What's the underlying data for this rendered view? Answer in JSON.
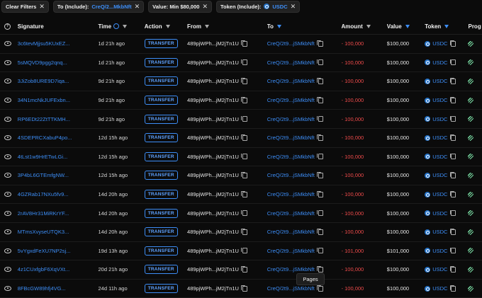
{
  "filters": {
    "clear_label": "Clear Filters",
    "to_prefix": "To (Include):",
    "to_value": "CreQ/2...MkbNft",
    "value_label": "Value: Min $80,000",
    "token_prefix": "Token (Include):",
    "token_value": "USDC"
  },
  "headers": {
    "signature": "Signature",
    "time": "Time",
    "action": "Action",
    "from": "From",
    "to": "To",
    "amount": "Amount",
    "value": "Value",
    "token": "Token",
    "program": "Prog"
  },
  "rows": [
    {
      "signature": "3c6tevMjjsu5KUxEZ...",
      "time": "1d 21h ago",
      "action": "TRANSFER",
      "from": "489pjWPh...jM2jTn1U",
      "to": "CreQ/2t9...jSMkbNft",
      "amount": "- 100,000",
      "value": "$100,000",
      "token": "USDC"
    },
    {
      "signature": "5sMQVD9pgg2qnq...",
      "time": "1d 21h ago",
      "action": "TRANSFER",
      "from": "489pjWPh...jM2jTn1U",
      "to": "CreQ/2t9...jSMkbNft",
      "amount": "- 100,000",
      "value": "$100,000",
      "token": "USDC"
    },
    {
      "signature": "3JiZob8URE9D7iqa...",
      "time": "9d 21h ago",
      "action": "TRANSFER",
      "from": "489pjWPh...jM2jTn1U",
      "to": "CreQ/2t9...jSMkbNft",
      "amount": "- 100,000",
      "value": "$100,000",
      "token": "USDC"
    },
    {
      "signature": "34N1mcNkJUFExbn...",
      "time": "9d 21h ago",
      "action": "TRANSFER",
      "from": "489pjWPh...jM2jTn1U",
      "to": "CreQ/2t9...jSMkbNft",
      "amount": "- 100,000",
      "value": "$100,000",
      "token": "USDC"
    },
    {
      "signature": "RP6EDt22ZtTTKMH...",
      "time": "9d 21h ago",
      "action": "TRANSFER",
      "from": "489pjWPh...jM2jTn1U",
      "to": "CreQ/2t9...jSMkbNft",
      "amount": "- 100,000",
      "value": "$100,000",
      "token": "USDC"
    },
    {
      "signature": "4SDEPRCXabuP4po...",
      "time": "12d 15h ago",
      "action": "TRANSFER",
      "from": "489pjWPh...jM2jTn1U",
      "to": "CreQ/2t9...jSMkbNft",
      "amount": "- 100,000",
      "value": "$100,000",
      "token": "USDC"
    },
    {
      "signature": "4tLst1w9HrETwLGi...",
      "time": "12d 15h ago",
      "action": "TRANSFER",
      "from": "489pjWPh...jM2jTn1U",
      "to": "CreQ/2t9...jSMkbNft",
      "amount": "- 100,000",
      "value": "$100,000",
      "token": "USDC"
    },
    {
      "signature": "3P4bL6GTEmfgNW...",
      "time": "12d 15h ago",
      "action": "TRANSFER",
      "from": "489pjWPh...jM2jTn1U",
      "to": "CreQ/2t9...jSMkbNft",
      "amount": "- 100,000",
      "value": "$100,000",
      "token": "USDC"
    },
    {
      "signature": "4GZRab17NXu5fv9...",
      "time": "14d 20h ago",
      "action": "TRANSFER",
      "from": "489pjWPh...jM2jTn1U",
      "to": "CreQ/2t9...jSMkbNft",
      "amount": "- 100,000",
      "value": "$100,000",
      "token": "USDC"
    },
    {
      "signature": "2rAV8Hr31MiRKrYF...",
      "time": "14d 20h ago",
      "action": "TRANSFER",
      "from": "489pjWPh...jM2jTn1U",
      "to": "CreQ/2t9...jSMkbNft",
      "amount": "- 100,000",
      "value": "$100,000",
      "token": "USDC"
    },
    {
      "signature": "MTmsXvyseUTQK3...",
      "time": "14d 20h ago",
      "action": "TRANSFER",
      "from": "489pjWPh...jM2jTn1U",
      "to": "CreQ/2t9...jSMkbNft",
      "amount": "- 100,000",
      "value": "$100,000",
      "token": "USDC"
    },
    {
      "signature": "5vYgxdFeXU7NP2sj...",
      "time": "19d 13h ago",
      "action": "TRANSFER",
      "from": "489pjWPh...jM2jTn1U",
      "to": "CreQ/2t9...jSMkbNft",
      "amount": "- 101,000",
      "value": "$101,000",
      "token": "USDC"
    },
    {
      "signature": "4z1CUxfgbF6XqVXt...",
      "time": "20d 21h ago",
      "action": "TRANSFER",
      "from": "489pjWPh...jM2jTn1U",
      "to": "CreQ/2t9...jSMkbNft",
      "amount": "- 100,000",
      "value": "$100,000",
      "token": "USDC"
    },
    {
      "signature": "8FBcGW89hfj4VG...",
      "time": "24d 11h ago",
      "action": "TRANSFER",
      "from": "489pjWPh...jM2jTn1U",
      "to": "CreQ/2t9...jSMkbNft",
      "amount": "- 100,000",
      "value": "$100,000",
      "token": "USDC"
    }
  ],
  "pages_label": "Pages",
  "colors": {
    "accent": "#3d8ef7",
    "negative": "#ef4b4b",
    "background": "#0b0b0b"
  }
}
